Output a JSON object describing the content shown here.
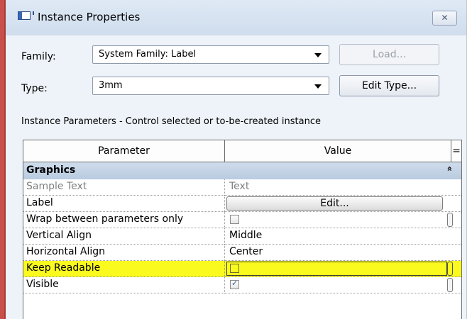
{
  "window": {
    "title": "Instance Properties",
    "close_glyph": "✕",
    "icon": "window-app-icon"
  },
  "family": {
    "label": "Family:",
    "value": "System Family: Label",
    "load_button": "Load..."
  },
  "type": {
    "label": "Type:",
    "value": "3mm",
    "edit_type_button": "Edit Type..."
  },
  "instance_caption": "Instance Parameters - Control selected or to-be-created instance",
  "table": {
    "headers": {
      "parameter": "Parameter",
      "value": "Value",
      "extra": "="
    },
    "group": {
      "name": "Graphics",
      "collapse_glyph": "»"
    },
    "rows": [
      {
        "name": "Sample Text",
        "value": "Text",
        "kind": "text-disabled"
      },
      {
        "name": "Label",
        "value": "Edit...",
        "kind": "button"
      },
      {
        "name": "Wrap between parameters only",
        "checked": false,
        "kind": "checkbox"
      },
      {
        "name": "Vertical Align",
        "value": "Middle",
        "kind": "text"
      },
      {
        "name": "Horizontal Align",
        "value": "Center",
        "kind": "text"
      },
      {
        "name": "Keep Readable",
        "checked": false,
        "kind": "checkbox",
        "highlighted": true
      },
      {
        "name": "Visible",
        "checked": true,
        "kind": "checkbox"
      }
    ]
  },
  "colors": {
    "highlight": "#fafa1e",
    "group_header": "#c4d4e8",
    "dialog_bg": "#eef3fa"
  }
}
